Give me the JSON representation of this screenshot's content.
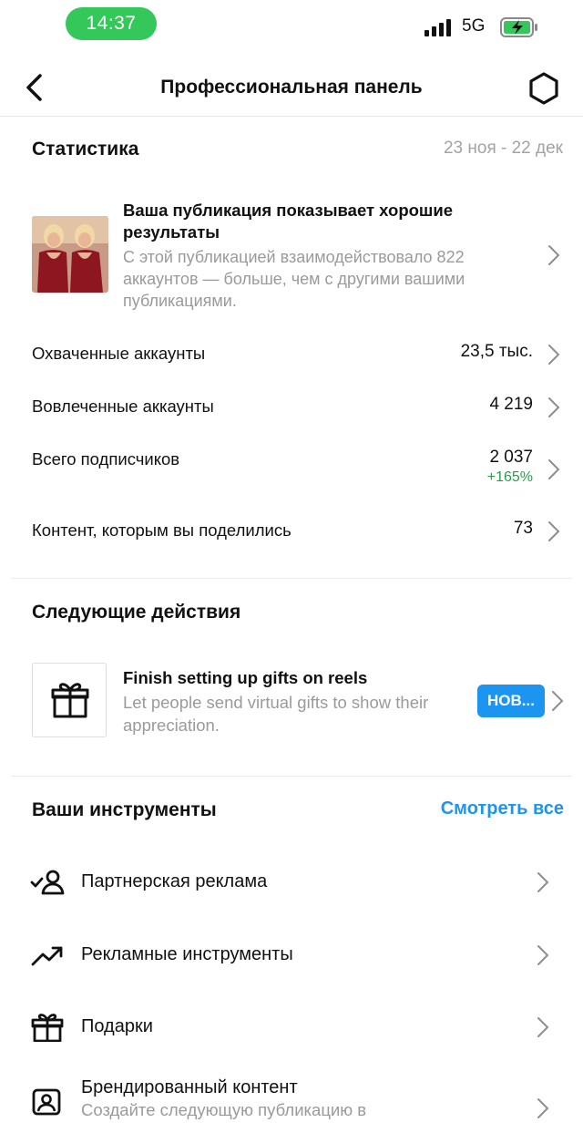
{
  "status_bar": {
    "time": "14:37",
    "network": "5G"
  },
  "nav": {
    "title": "Профессиональная панель"
  },
  "statistics": {
    "title": "Статистика",
    "date_range": "23 ноя - 22 дек",
    "highlight": {
      "title": "Ваша публикация показывает хорошие результаты",
      "description": "С этой публикацией взаимодействовало 822 аккаунтов — больше, чем с другими вашими публикациями."
    },
    "rows": [
      {
        "label": "Охваченные аккаунты",
        "value": "23,5 тыс."
      },
      {
        "label": "Вовлеченные аккаунты",
        "value": "4 219"
      },
      {
        "label": "Всего подписчиков",
        "value": "2 037",
        "delta": "+165%"
      },
      {
        "label": "Контент, которым вы поделились",
        "value": "73"
      }
    ]
  },
  "next_actions": {
    "title": "Следующие действия",
    "item": {
      "title": "Finish setting up gifts on reels",
      "description": "Let people send virtual gifts to show their appreciation.",
      "badge": "НОВ..."
    }
  },
  "tools": {
    "title": "Ваши инструменты",
    "see_all": "Смотреть все",
    "items": [
      {
        "label": "Партнерская реклама",
        "icon": "partner-ads-icon"
      },
      {
        "label": "Рекламные инструменты",
        "icon": "trending-up-icon"
      },
      {
        "label": "Подарки",
        "icon": "gift-icon"
      },
      {
        "label": "Брендированный контент",
        "sublabel": "Создайте следующую публикацию в",
        "icon": "branded-content-icon"
      }
    ]
  },
  "colors": {
    "accent": "#1b95f0",
    "positive": "#22a045",
    "status_pill": "#34c759",
    "muted": "#9a9a9a"
  }
}
